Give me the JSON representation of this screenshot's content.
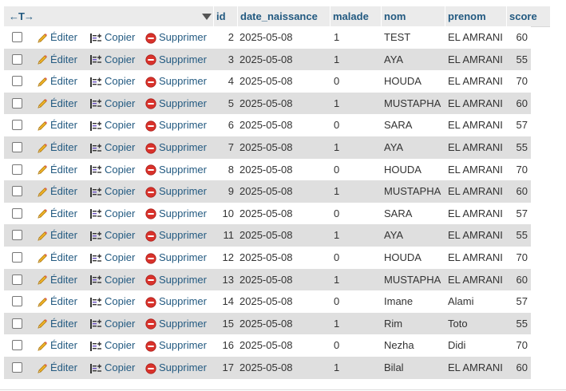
{
  "header": {
    "arrows_label": "←T→",
    "columns": [
      "id",
      "date_naissance",
      "malade",
      "nom",
      "prenom",
      "score"
    ]
  },
  "actions": {
    "edit": "Éditer",
    "copy": "Copier",
    "delete": "Supprimer"
  },
  "rows": [
    {
      "id": "2",
      "date": "2025-05-08",
      "malade": "1",
      "nom": "TEST",
      "prenom": "EL AMRANI",
      "score": "60"
    },
    {
      "id": "3",
      "date": "2025-05-08",
      "malade": "1",
      "nom": "AYA",
      "prenom": "EL AMRANI",
      "score": "55"
    },
    {
      "id": "4",
      "date": "2025-05-08",
      "malade": "0",
      "nom": "HOUDA",
      "prenom": "EL AMRANI",
      "score": "70"
    },
    {
      "id": "5",
      "date": "2025-05-08",
      "malade": "1",
      "nom": "MUSTAPHA",
      "prenom": "EL AMRANI",
      "score": "60"
    },
    {
      "id": "6",
      "date": "2025-05-08",
      "malade": "0",
      "nom": "SARA",
      "prenom": "EL AMRANI",
      "score": "57"
    },
    {
      "id": "7",
      "date": "2025-05-08",
      "malade": "1",
      "nom": "AYA",
      "prenom": "EL AMRANI",
      "score": "55"
    },
    {
      "id": "8",
      "date": "2025-05-08",
      "malade": "0",
      "nom": "HOUDA",
      "prenom": "EL AMRANI",
      "score": "70"
    },
    {
      "id": "9",
      "date": "2025-05-08",
      "malade": "1",
      "nom": "MUSTAPHA",
      "prenom": "EL AMRANI",
      "score": "60"
    },
    {
      "id": "10",
      "date": "2025-05-08",
      "malade": "0",
      "nom": "SARA",
      "prenom": "EL AMRANI",
      "score": "57"
    },
    {
      "id": "11",
      "date": "2025-05-08",
      "malade": "1",
      "nom": "AYA",
      "prenom": "EL AMRANI",
      "score": "55"
    },
    {
      "id": "12",
      "date": "2025-05-08",
      "malade": "0",
      "nom": "HOUDA",
      "prenom": "EL AMRANI",
      "score": "70"
    },
    {
      "id": "13",
      "date": "2025-05-08",
      "malade": "1",
      "nom": "MUSTAPHA",
      "prenom": "EL AMRANI",
      "score": "60"
    },
    {
      "id": "14",
      "date": "2025-05-08",
      "malade": "0",
      "nom": "Imane",
      "prenom": "Alami",
      "score": "57"
    },
    {
      "id": "15",
      "date": "2025-05-08",
      "malade": "1",
      "nom": "Rim",
      "prenom": "Toto",
      "score": "55"
    },
    {
      "id": "16",
      "date": "2025-05-08",
      "malade": "0",
      "nom": "Nezha",
      "prenom": "Didi",
      "score": "70"
    },
    {
      "id": "17",
      "date": "2025-05-08",
      "malade": "1",
      "nom": "Bilal",
      "prenom": "EL AMRANI",
      "score": "60"
    }
  ],
  "colors": {
    "link": "#235a81",
    "row_even": "#dfdfdf",
    "header_bg": "#ebebeb",
    "delete_red": "#d9322b",
    "pencil_orange": "#e8a317"
  },
  "icons": {
    "edit": "pencil-icon",
    "copy": "copy-icon",
    "delete": "delete-icon",
    "sort": "sort-arrow-icon"
  }
}
